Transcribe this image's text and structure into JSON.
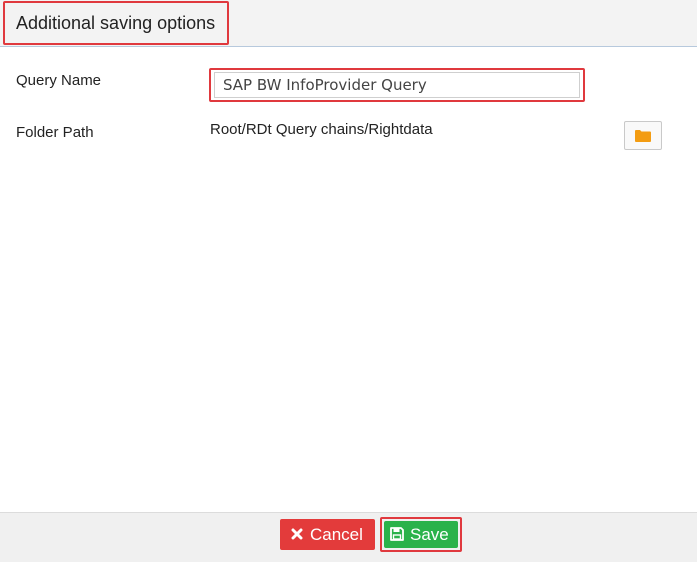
{
  "header": {
    "title": "Additional saving options"
  },
  "form": {
    "query_name_label": "Query Name",
    "query_name_value": "SAP BW InfoProvider Query",
    "folder_path_label": "Folder Path",
    "folder_path_value": "Root/RDt Query chains/Rightdata"
  },
  "footer": {
    "cancel_label": "Cancel",
    "save_label": "Save"
  },
  "icons": {
    "folder": "folder-icon",
    "cancel": "x-icon",
    "save": "floppy-disk-icon"
  },
  "colors": {
    "folder_icon": "#f39c12",
    "cancel_button": "#e33b3b",
    "save_button": "#2ab24a",
    "highlight_border": "#e0393e"
  }
}
